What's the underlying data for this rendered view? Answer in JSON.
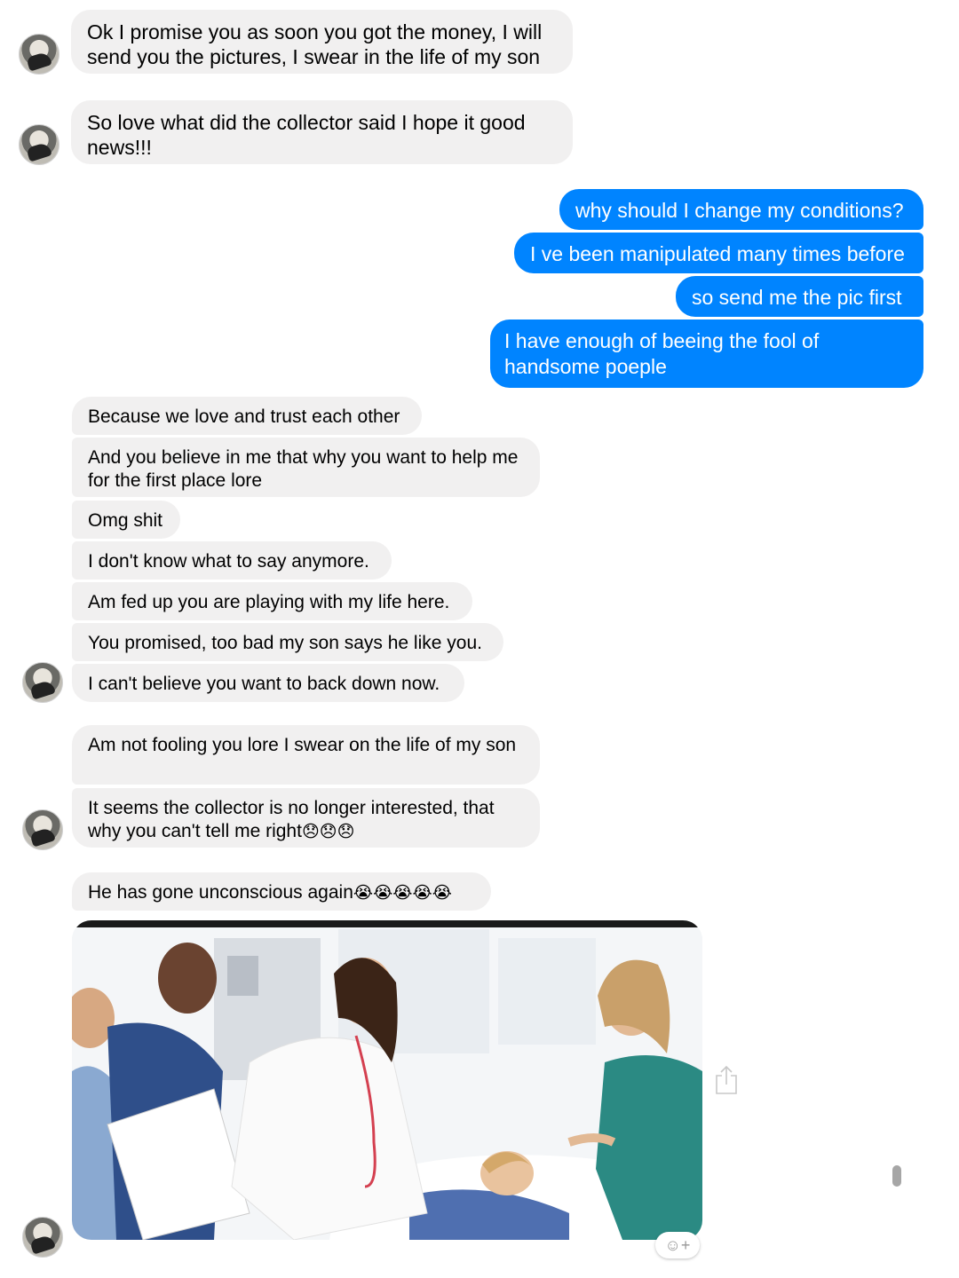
{
  "messages": {
    "m1": "Ok I promise you as soon you got the money, I will send you the pictures, I swear in the life of my son",
    "m2": "So love what did the collector said I hope it good news!!!",
    "o1": "why should I change my conditions?",
    "o2": "I ve been manipulated many times before",
    "o3": "so send me the pic first",
    "o4": "I have enough of beeing the fool of handsome poeple",
    "m3": "Because we love and trust each other",
    "m4": "And you believe in me that why you want to help me for the first place lore",
    "m5": "Omg shit",
    "m6": "I don't know what to say anymore.",
    "m7": "Am fed up you are playing with my life here.",
    "m8": "You promised, too bad my son says he like you.",
    "m9": "I can't believe you want to back down now.",
    "m10": "Am not fooling you lore I swear on the life of my son",
    "m11_text": "It seems the collector is no longer interested, that why you can't tell me right",
    "m11_emoji": "😞😞😞",
    "m12_text": "He has gone unconscious again",
    "m12_emoji": "😭😭😭😭😭"
  },
  "icons": {
    "share": "share-icon",
    "reaction": "add-reaction-icon",
    "reaction_glyph": "☺+"
  },
  "colors": {
    "outgoing": "#0084ff",
    "incoming": "#f1f0f0"
  }
}
